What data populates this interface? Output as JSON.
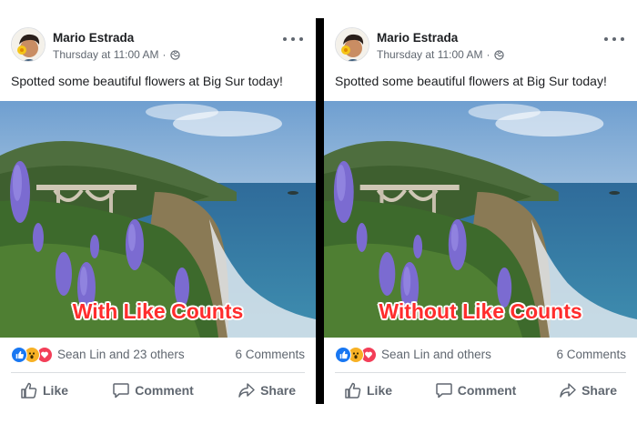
{
  "left_post": {
    "author": "Mario Estrada",
    "timestamp": "Thursday at 11:00 AM",
    "separator": "·",
    "caption": "Spotted some beautiful flowers at Big Sur today!",
    "overlay_label": "With Like Counts",
    "reactions_text": "Sean Lin and 23 others",
    "comments_text": "6 Comments",
    "actions": {
      "like": "Like",
      "comment": "Comment",
      "share": "Share"
    }
  },
  "right_post": {
    "author": "Mario Estrada",
    "timestamp": "Thursday at 11:00 AM",
    "separator": "·",
    "caption": "Spotted some beautiful flowers at Big Sur today!",
    "overlay_label": "Without Like Counts",
    "reactions_text": "Sean Lin and others",
    "comments_text": "6 Comments",
    "actions": {
      "like": "Like",
      "comment": "Comment",
      "share": "Share"
    }
  },
  "icons": {
    "privacy": "globe-icon",
    "more": "more-options-icon",
    "reaction_set": [
      "like-reaction-icon",
      "wow-reaction-icon",
      "love-reaction-icon"
    ],
    "like": "thumbs-up-icon",
    "comment": "comment-bubble-icon",
    "share": "share-arrow-icon"
  },
  "colors": {
    "overlay_text": "#ff2d2d",
    "secondary_text": "#606770",
    "like_blue": "#1877f2",
    "wow_yellow": "#f7b125",
    "love_red": "#f33e58",
    "divider": "#000000"
  }
}
